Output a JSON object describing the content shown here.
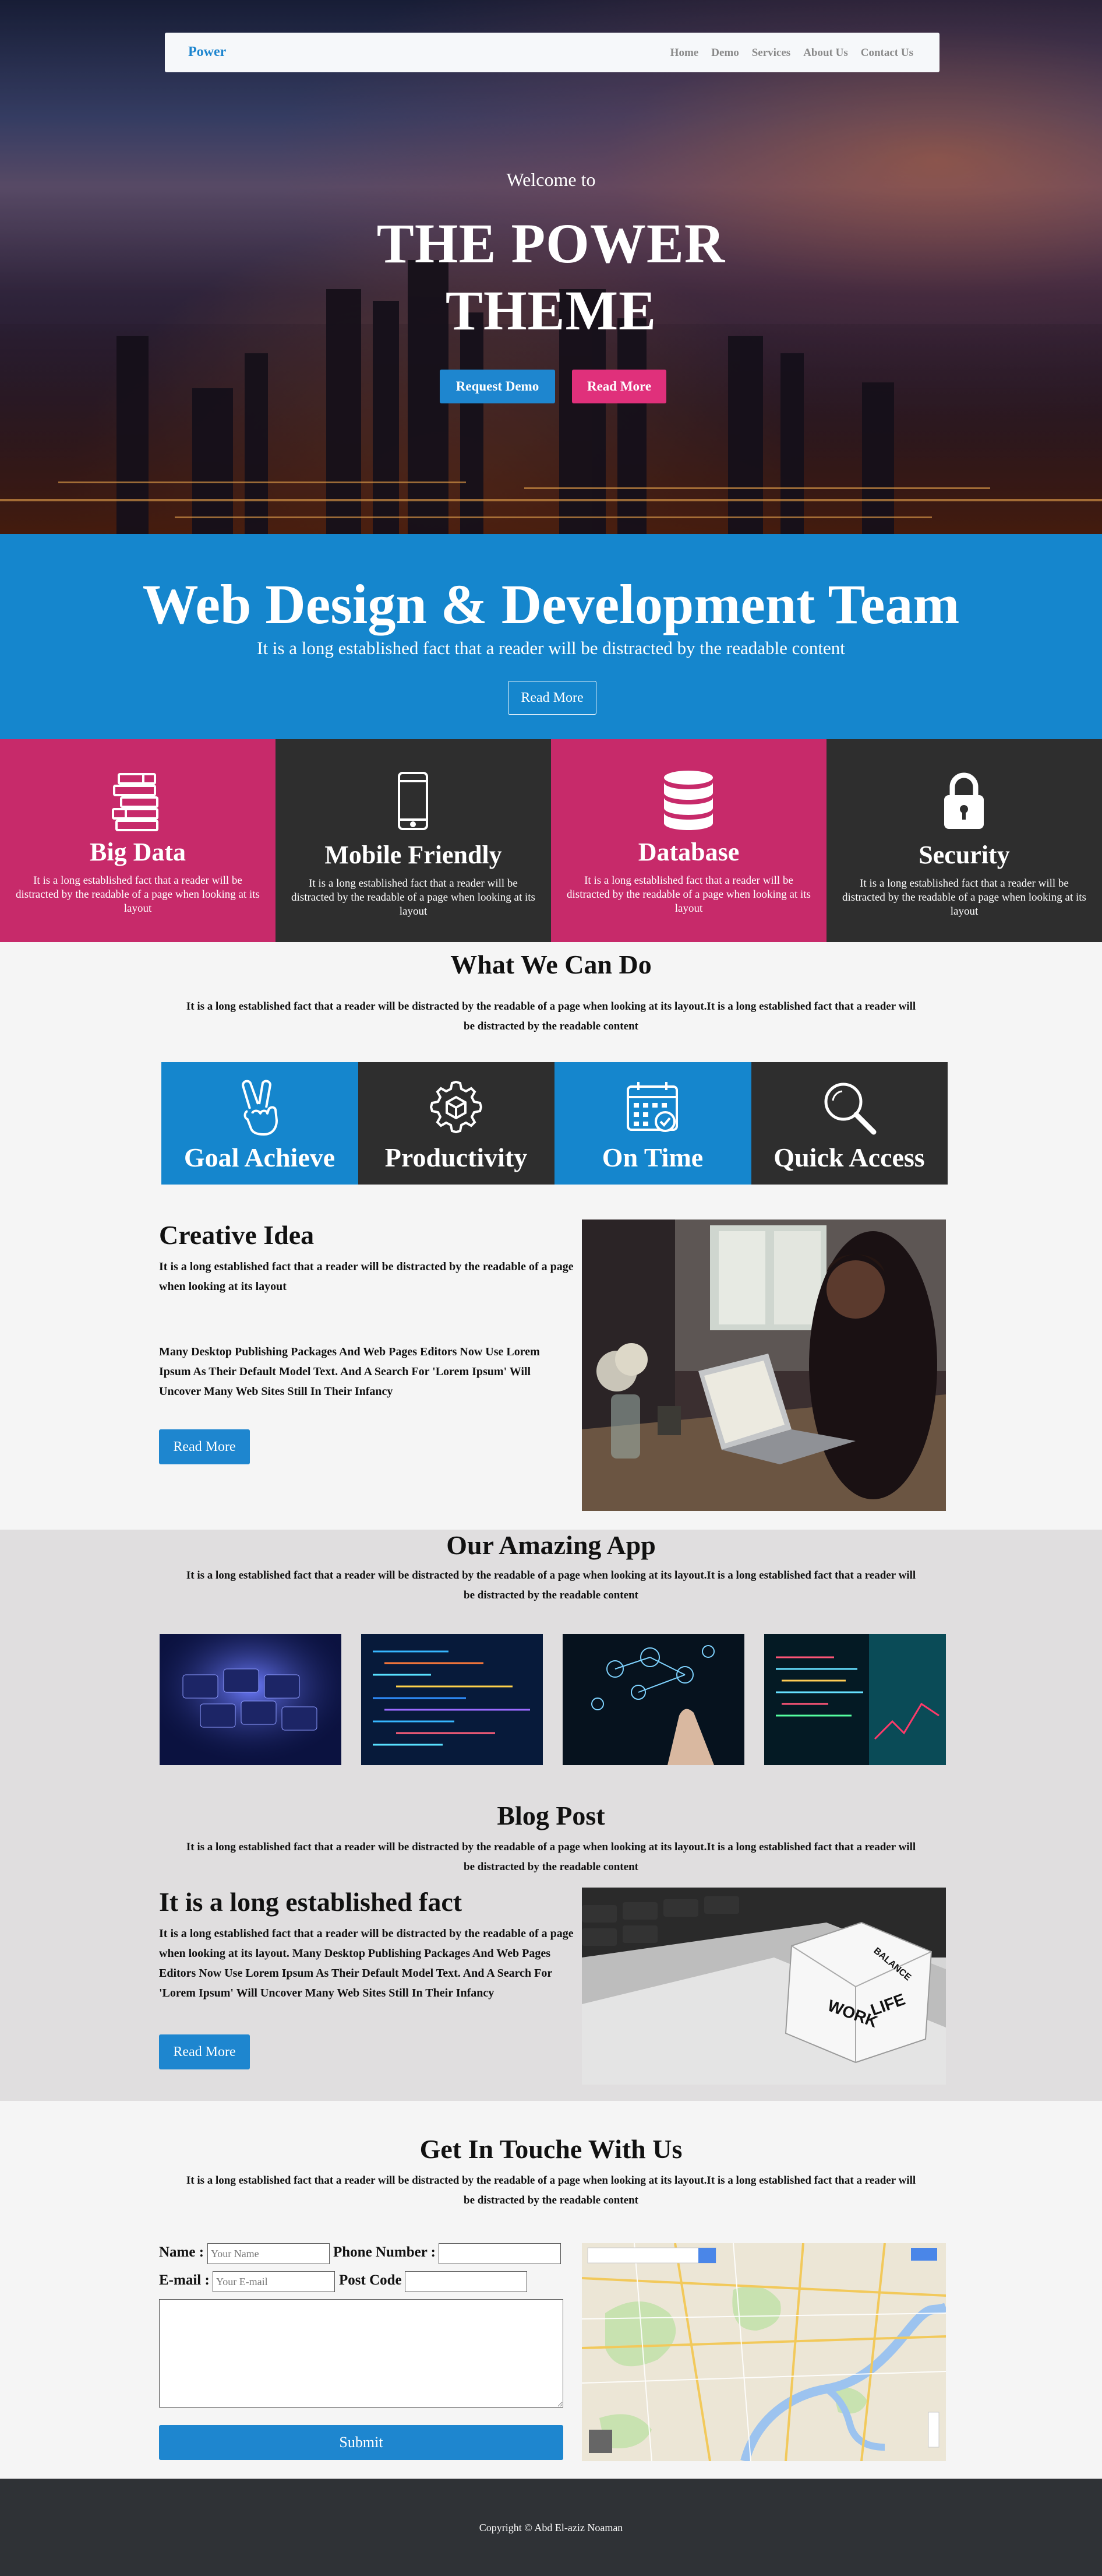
{
  "nav": {
    "brand": "Power",
    "links": [
      "Home",
      "Demo",
      "Services",
      "About Us",
      "Contact Us"
    ]
  },
  "hero": {
    "welcome": "Welcome to",
    "title_line1": "THE POWER",
    "title_line2": "THEME",
    "btn_demo": "Request Demo",
    "btn_more": "Read More"
  },
  "team": {
    "title": "Web Design & Development Team",
    "subtitle": "It is a long established fact that a reader will be distracted by the readable content",
    "button": "Read More"
  },
  "features": [
    {
      "title": "Big Data",
      "text": "It is a long established fact that a reader will be distracted by the readable of a page when looking at its layout",
      "color": "#c72a6a",
      "icon": "books-icon"
    },
    {
      "title": "Mobile Friendly",
      "text": "It is a long established fact that a reader will be distracted by the readable of a page when looking at its layout",
      "color": "#2e2e2e",
      "icon": "mobile-phone-icon"
    },
    {
      "title": "Database",
      "text": "It is a long established fact that a reader will be distracted by the readable of a page when looking at its layout",
      "color": "#c72a6a",
      "icon": "database-icon"
    },
    {
      "title": "Security",
      "text": "It is a long established fact that a reader will be distracted by the readable of a page when looking at its layout",
      "color": "#2e2e2e",
      "icon": "padlock-icon"
    }
  ],
  "what_we_do": {
    "title": "What We Can Do",
    "subtitle": "It is a long established fact that a reader will be distracted by the readable of a page when looking at its layout.It is a long established fact that a reader will be distracted by the readable content",
    "services": [
      {
        "title": "Goal Achieve",
        "color": "#1586cd",
        "icon": "victory-hand-icon"
      },
      {
        "title": "Productivity",
        "color": "#2e2e2e",
        "icon": "gear-box-icon"
      },
      {
        "title": "On Time",
        "color": "#1586cd",
        "icon": "calendar-check-icon"
      },
      {
        "title": "Quick Access",
        "color": "#2e2e2e",
        "icon": "magnifier-icon"
      }
    ]
  },
  "creative": {
    "title": "Creative Idea",
    "p1": "It is a long established fact that a reader will be distracted by the readable of a page when looking at its layout",
    "p2": "Many Desktop Publishing Packages And Web Pages Editors Now Use Lorem Ipsum As Their Default Model Text. And A Search For 'Lorem Ipsum' Will Uncover Many Web Sites Still In Their Infancy",
    "button": "Read More"
  },
  "app": {
    "title": "Our Amazing App",
    "subtitle": "It is a long established fact that a reader will be distracted by the readable of a page when looking at its layout.It is a long established fact that a reader will be distracted by the readable content"
  },
  "blog": {
    "title": "Blog Post",
    "subtitle": "It is a long established fact that a reader will be distracted by the readable of a page when looking at its layout.It is a long established fact that a reader will be distracted by the readable content",
    "post_title": "It is a long established fact",
    "post_text": "It is a long established fact that a reader will be distracted by the readable of a page when looking at its layout. Many Desktop Publishing Packages And Web Pages Editors Now Use Lorem Ipsum As Their Default Model Text. And A Search For 'Lorem Ipsum' Will Uncover Many Web Sites Still In Their Infancy",
    "button": "Read More",
    "image_words": [
      "WORK",
      "LIFE",
      "BALANCE"
    ]
  },
  "contact": {
    "title": "Get In Touche With Us",
    "subtitle": "It is a long established fact that a reader will be distracted by the readable of a page when looking at its layout.It is a long established fact that a reader will be distracted by the readable content",
    "name_label": "Name :",
    "name_placeholder": "Your Name",
    "phone_label": "Phone Number :",
    "email_label": "E-mail :",
    "email_placeholder": "Your E-mail",
    "postcode_label": "Post Code",
    "submit": "Submit"
  },
  "footer": {
    "text": "Copyright © Abd El-aziz Noaman"
  }
}
